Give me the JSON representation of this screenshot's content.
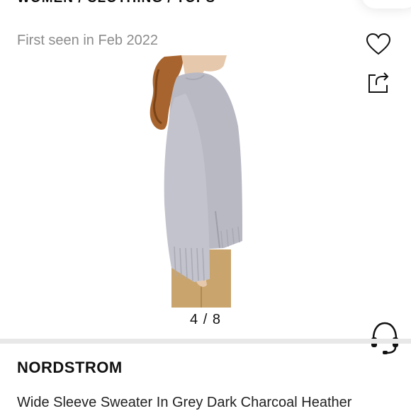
{
  "breadcrumb": "WOMEN / CLOTHING / TOPS",
  "first_seen": "First seen in Feb 2022",
  "gallery": {
    "counter": "4 / 8",
    "current": 4,
    "total": 8
  },
  "product": {
    "brand": "NORDSTROM",
    "title": "Wide Sleeve Sweater In Grey Dark Charcoal Heather"
  },
  "icons": {
    "like": "heart-icon",
    "share": "share-icon",
    "support": "headset-icon"
  },
  "colors": {
    "text_primary": "#111111",
    "text_muted": "#8c8c8c",
    "divider": "#e8e8e8",
    "sweater": "#b9b9c4",
    "pants": "#c9a46c"
  }
}
